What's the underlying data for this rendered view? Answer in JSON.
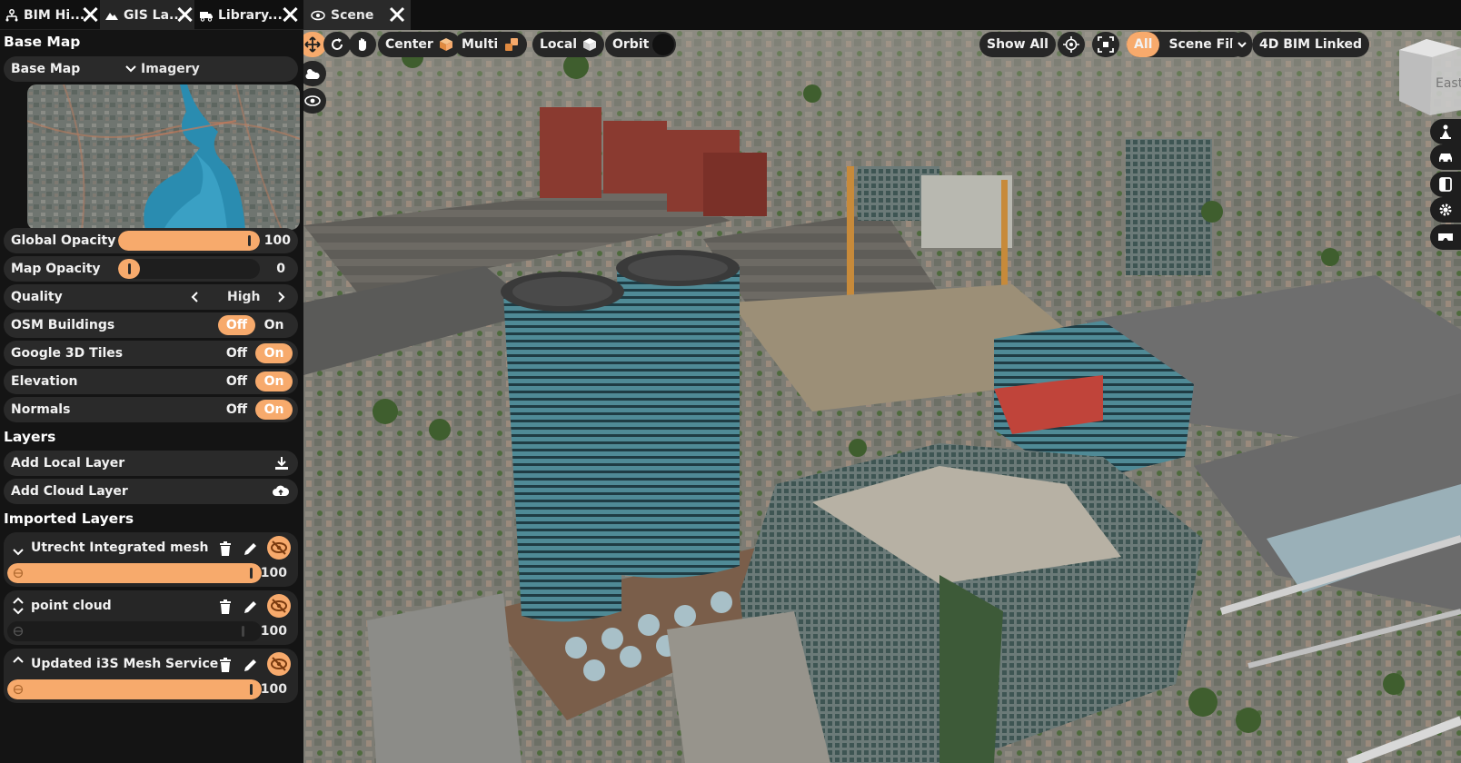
{
  "tabs": [
    {
      "label": "BIM Hi...",
      "icon": "hierarchy-icon"
    },
    {
      "label": "GIS La...",
      "icon": "terrain-icon"
    },
    {
      "label": "Library...",
      "icon": "library-truck-icon"
    }
  ],
  "scene_tab": {
    "label": "Scene",
    "icon": "eye-icon"
  },
  "base_map": {
    "section_title": "Base Map",
    "row_label": "Base Map",
    "selected": "Imagery"
  },
  "settings": {
    "global_opacity": {
      "label": "Global Opacity",
      "value": "100",
      "fraction": 1.0
    },
    "map_opacity": {
      "label": "Map Opacity",
      "value": "0",
      "fraction": 0.0
    },
    "quality": {
      "label": "Quality",
      "value": "High"
    },
    "osm_buildings": {
      "label": "OSM Buildings",
      "off": "Off",
      "on": "On",
      "selected": "off"
    },
    "google_3d_tiles": {
      "label": "Google 3D Tiles",
      "off": "Off",
      "on": "On",
      "selected": "on"
    },
    "elevation": {
      "label": "Elevation",
      "off": "Off",
      "on": "On",
      "selected": "on"
    },
    "normals": {
      "label": "Normals",
      "off": "Off",
      "on": "On",
      "selected": "on"
    }
  },
  "layers": {
    "section_title": "Layers",
    "add_local": "Add Local Layer",
    "add_cloud": "Add Cloud Layer"
  },
  "imported": {
    "section_title": "Imported Layers",
    "items": [
      {
        "name": "Utrecht Integrated mesh",
        "value": "100",
        "fraction": 1.0
      },
      {
        "name": "point cloud",
        "value": "100",
        "fraction": 0.0
      },
      {
        "name": "Updated i3S Mesh Service",
        "value": "100",
        "fraction": 1.0
      }
    ]
  },
  "toolbar": {
    "center": "Center",
    "multi": "Multi",
    "local": "Local",
    "orbit": "Orbit",
    "show_all": "Show All",
    "all": "All",
    "scene_filter": "Scene Filter",
    "bim_linked": "4D BIM Linked"
  },
  "nav_cube": {
    "face": "East"
  },
  "colors": {
    "accent": "#f7aa6c",
    "panel": "#141414",
    "row": "#2a2a2a"
  }
}
